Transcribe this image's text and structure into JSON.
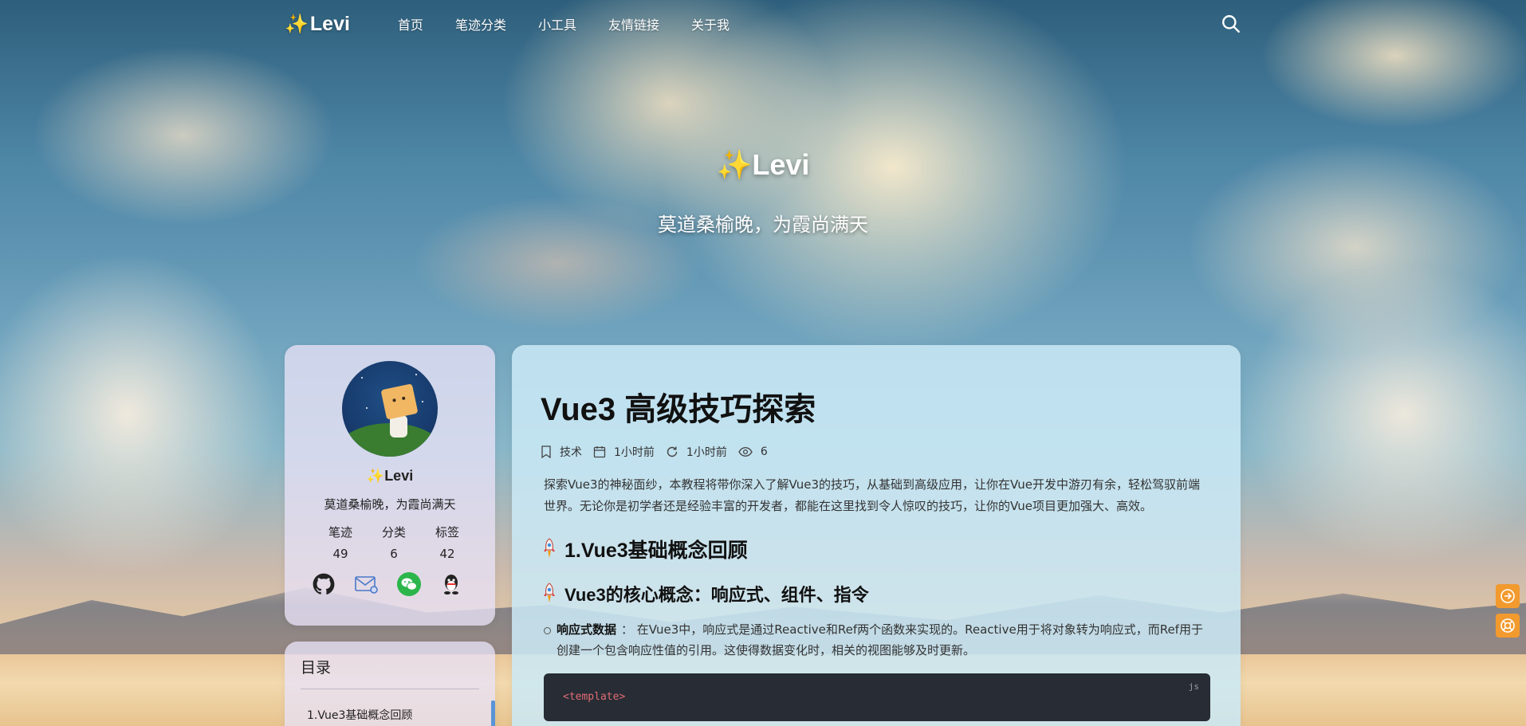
{
  "nav": {
    "brand_spark": "✨",
    "brand_name": "Levi",
    "items": [
      "首页",
      "笔迹分类",
      "小工具",
      "友情链接",
      "关于我"
    ]
  },
  "hero": {
    "spark": "✨",
    "title": "Levi",
    "subtitle": "莫道桑榆晚，为霞尚满天"
  },
  "profile": {
    "spark": "✨",
    "name": "Levi",
    "motto": "莫道桑榆晚，为霞尚满天",
    "stats": [
      {
        "label": "笔迹",
        "value": "49"
      },
      {
        "label": "分类",
        "value": "6"
      },
      {
        "label": "标签",
        "value": "42"
      }
    ],
    "socials": [
      "github-icon",
      "email-icon",
      "wechat-icon",
      "qq-icon"
    ]
  },
  "toc": {
    "title": "目录",
    "items": [
      "1.Vue3基础概念回顾"
    ]
  },
  "article": {
    "title": "Vue3 高级技巧探索",
    "meta": {
      "category": "技术",
      "created": "1小时前",
      "updated": "1小时前",
      "views": "6"
    },
    "lead": "探索Vue3的神秘面纱，本教程将带你深入了解Vue3的技巧，从基础到高级应用，让你在Vue开发中游刃有余，轻松驾驭前端世界。无论你是初学者还是经验丰富的开发者，都能在这里找到令人惊叹的技巧，让你的Vue项目更加强大、高效。",
    "h2": "1.Vue3基础概念回顾",
    "h3": "Vue3的核心概念：响应式、组件、指令",
    "list": [
      {
        "term": "响应式数据",
        "desc": "： 在Vue3中，响应式是通过Reactive和Ref两个函数来实现的。Reactive用于将对象转为响应式，而Ref用于创建一个包含响应性值的引用。这使得数据变化时，相关的视图能够及时更新。"
      }
    ],
    "code": {
      "lang": "js",
      "first_line": "<template>"
    }
  },
  "colors": {
    "accent": "#f29a2e",
    "toc_bar": "#5a93d6",
    "code_bg": "#282c34"
  }
}
